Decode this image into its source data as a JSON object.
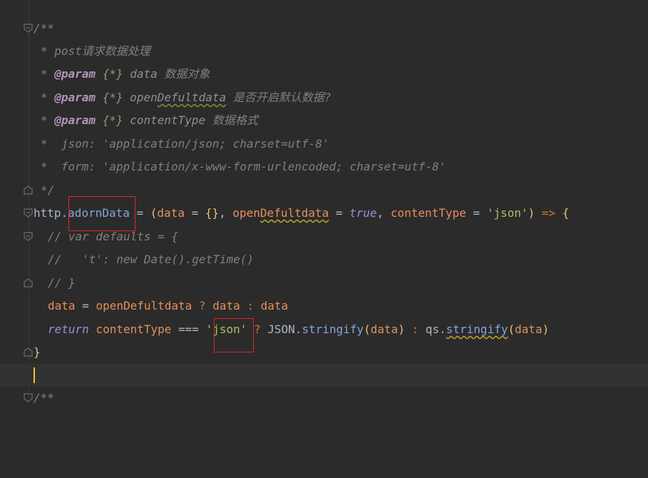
{
  "editor": {
    "lines": [
      {
        "segments": [
          "/**"
        ]
      },
      {
        "segments": [
          "* post",
          "请求数据处理"
        ]
      },
      {
        "segments": [
          "* ",
          "@param",
          " {*}",
          " data ",
          "数据对象"
        ]
      },
      {
        "segments": [
          "* ",
          "@param",
          " {*}",
          " open",
          "Defultdata",
          " 是否开启默认数据?"
        ]
      },
      {
        "segments": [
          "* ",
          "@param",
          " {*}",
          " contentType ",
          "数据格式"
        ]
      },
      {
        "segments": [
          "*  json: 'application/json; charset=utf-8'"
        ]
      },
      {
        "segments": [
          "*  form: 'application/x-www-form-urlencoded; charset=utf-8'"
        ]
      },
      {
        "segments": [
          "*/"
        ]
      },
      {
        "segments": [
          "http",
          ".",
          "adornData",
          " = ",
          "(",
          "data",
          " = ",
          "{}",
          ", ",
          "open",
          "Defultdata",
          " = ",
          "true",
          ", ",
          "contentType",
          " = ",
          "'json'",
          ")",
          " => ",
          "{"
        ]
      },
      {
        "segments": [
          "// var defaults = {"
        ]
      },
      {
        "segments": [
          "//   't': new Date().getTime()"
        ]
      },
      {
        "segments": [
          "// }"
        ]
      },
      {
        "segments": [
          "data",
          " = ",
          "openDefultdata",
          " ? ",
          "data",
          " : ",
          "data"
        ]
      },
      {
        "segments": [
          "return",
          " contentType",
          " === ",
          "'json'",
          " ? ",
          "JSON",
          ".",
          "stringify",
          "(",
          "data",
          ")",
          " : ",
          "qs",
          ".",
          "stringify",
          "(",
          "data",
          ")"
        ]
      },
      {
        "segments": [
          "}"
        ]
      },
      {
        "segments": [
          ""
        ]
      },
      {
        "segments": [
          "/**"
        ]
      }
    ]
  },
  "colors": {
    "background": "#2b2b2b",
    "current_line": "#323232",
    "highlight_box": "#e0262b",
    "caret": "#f5c518"
  }
}
